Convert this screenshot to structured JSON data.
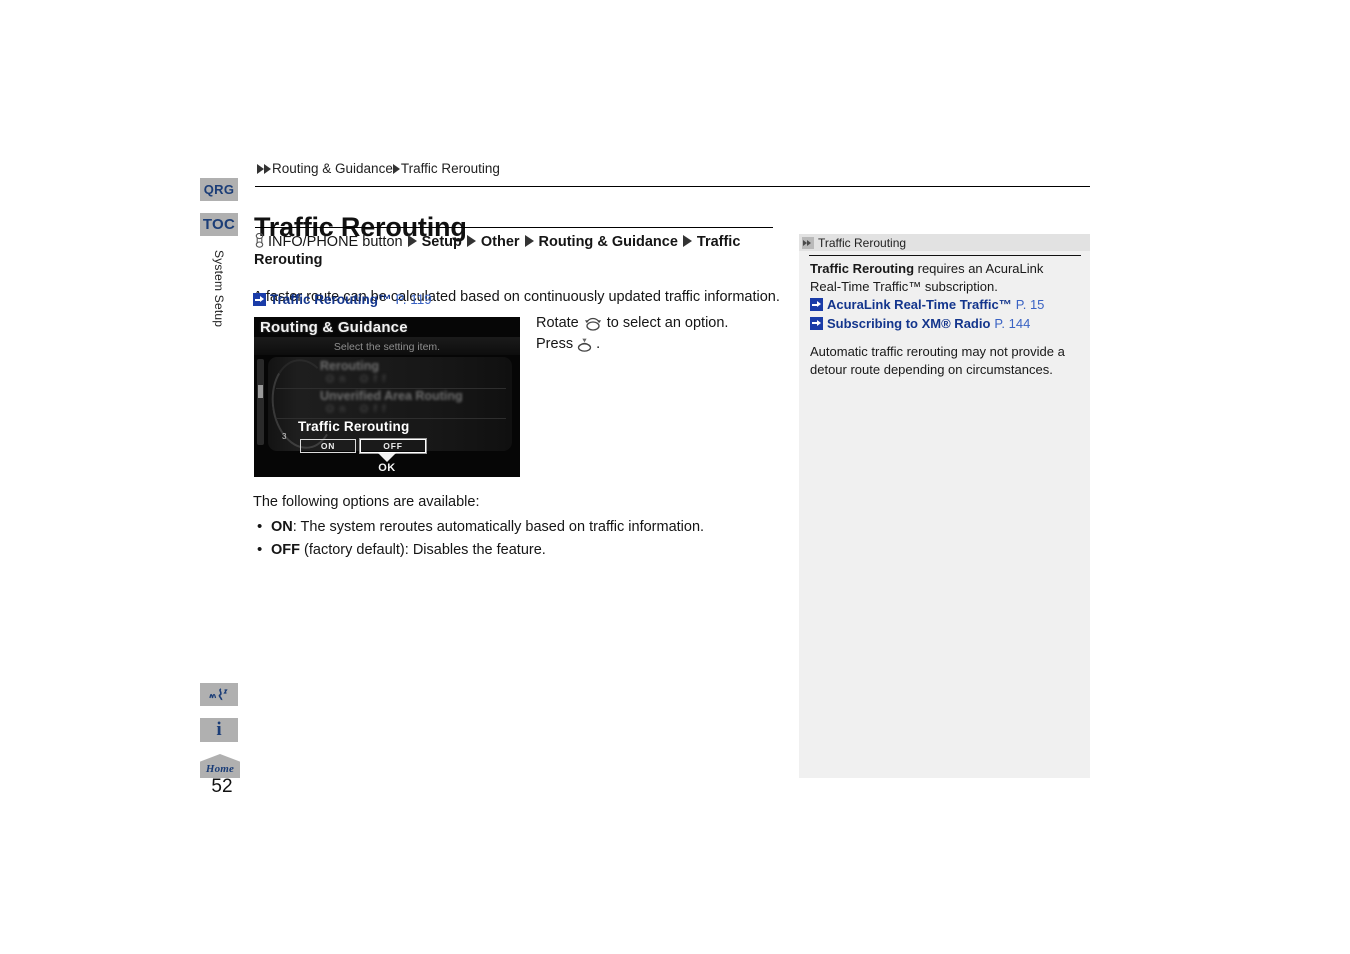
{
  "rail": {
    "qrg_label": "QRG",
    "toc_label": "TOC",
    "section_label": "System Setup",
    "page_number": "52",
    "home_label": "Home"
  },
  "breadcrumb": {
    "parent": "Routing & Guidance",
    "current": "Traffic Rerouting"
  },
  "header": {
    "title": "Traffic Rerouting"
  },
  "path": {
    "button": "INFO/PHONE button",
    "step1": "Setup",
    "step2": "Other",
    "step3": "Routing & Guidance",
    "step4": "Traffic Rerouting"
  },
  "lede": {
    "text": "A faster route can be calculated based on continuously updated traffic information."
  },
  "xref": {
    "label": "Traffic Rerouting™",
    "page": "P. 119"
  },
  "navshot": {
    "title": "Routing & Guidance",
    "subtitle": "Select the setting item.",
    "rows": [
      {
        "label": "Rerouting",
        "value": "On Off"
      },
      {
        "label": "Unverified Area Routing",
        "value": "On Off"
      }
    ],
    "selected": {
      "index": "3",
      "label": "Traffic Rerouting",
      "option_on": "ON",
      "option_off": "OFF"
    },
    "ok_label": "OK"
  },
  "instructions": {
    "rotate_pre": "Rotate",
    "rotate_post": "to select an option.",
    "press_pre": "Press",
    "press_post": "."
  },
  "options": {
    "intro": "The following options are available:",
    "items": [
      {
        "name": "ON",
        "desc": ": The system reroutes automatically based on traffic information."
      },
      {
        "name": "OFF",
        "desc": " (factory default): Disables the feature."
      }
    ]
  },
  "sidebar": {
    "title": "Traffic Rerouting",
    "note_bold": "Traffic Rerouting",
    "note_rest": " requires an AcuraLink Real-Time Traffic™ subscription.",
    "links": [
      {
        "label": "AcuraLink Real-Time Traffic™",
        "page": "P. 15"
      },
      {
        "label": "Subscribing to XM® Radio",
        "page": "P. 144"
      }
    ],
    "footnote": "Automatic traffic rerouting may not provide a detour route depending on circumstances."
  },
  "colors": {
    "link_blue": "#13358c",
    "page_blue": "#3a63c4",
    "rail_gray": "#b0b0b0",
    "panel_gray": "#f0f0f0",
    "panel_head_gray": "#e2e2e2"
  }
}
